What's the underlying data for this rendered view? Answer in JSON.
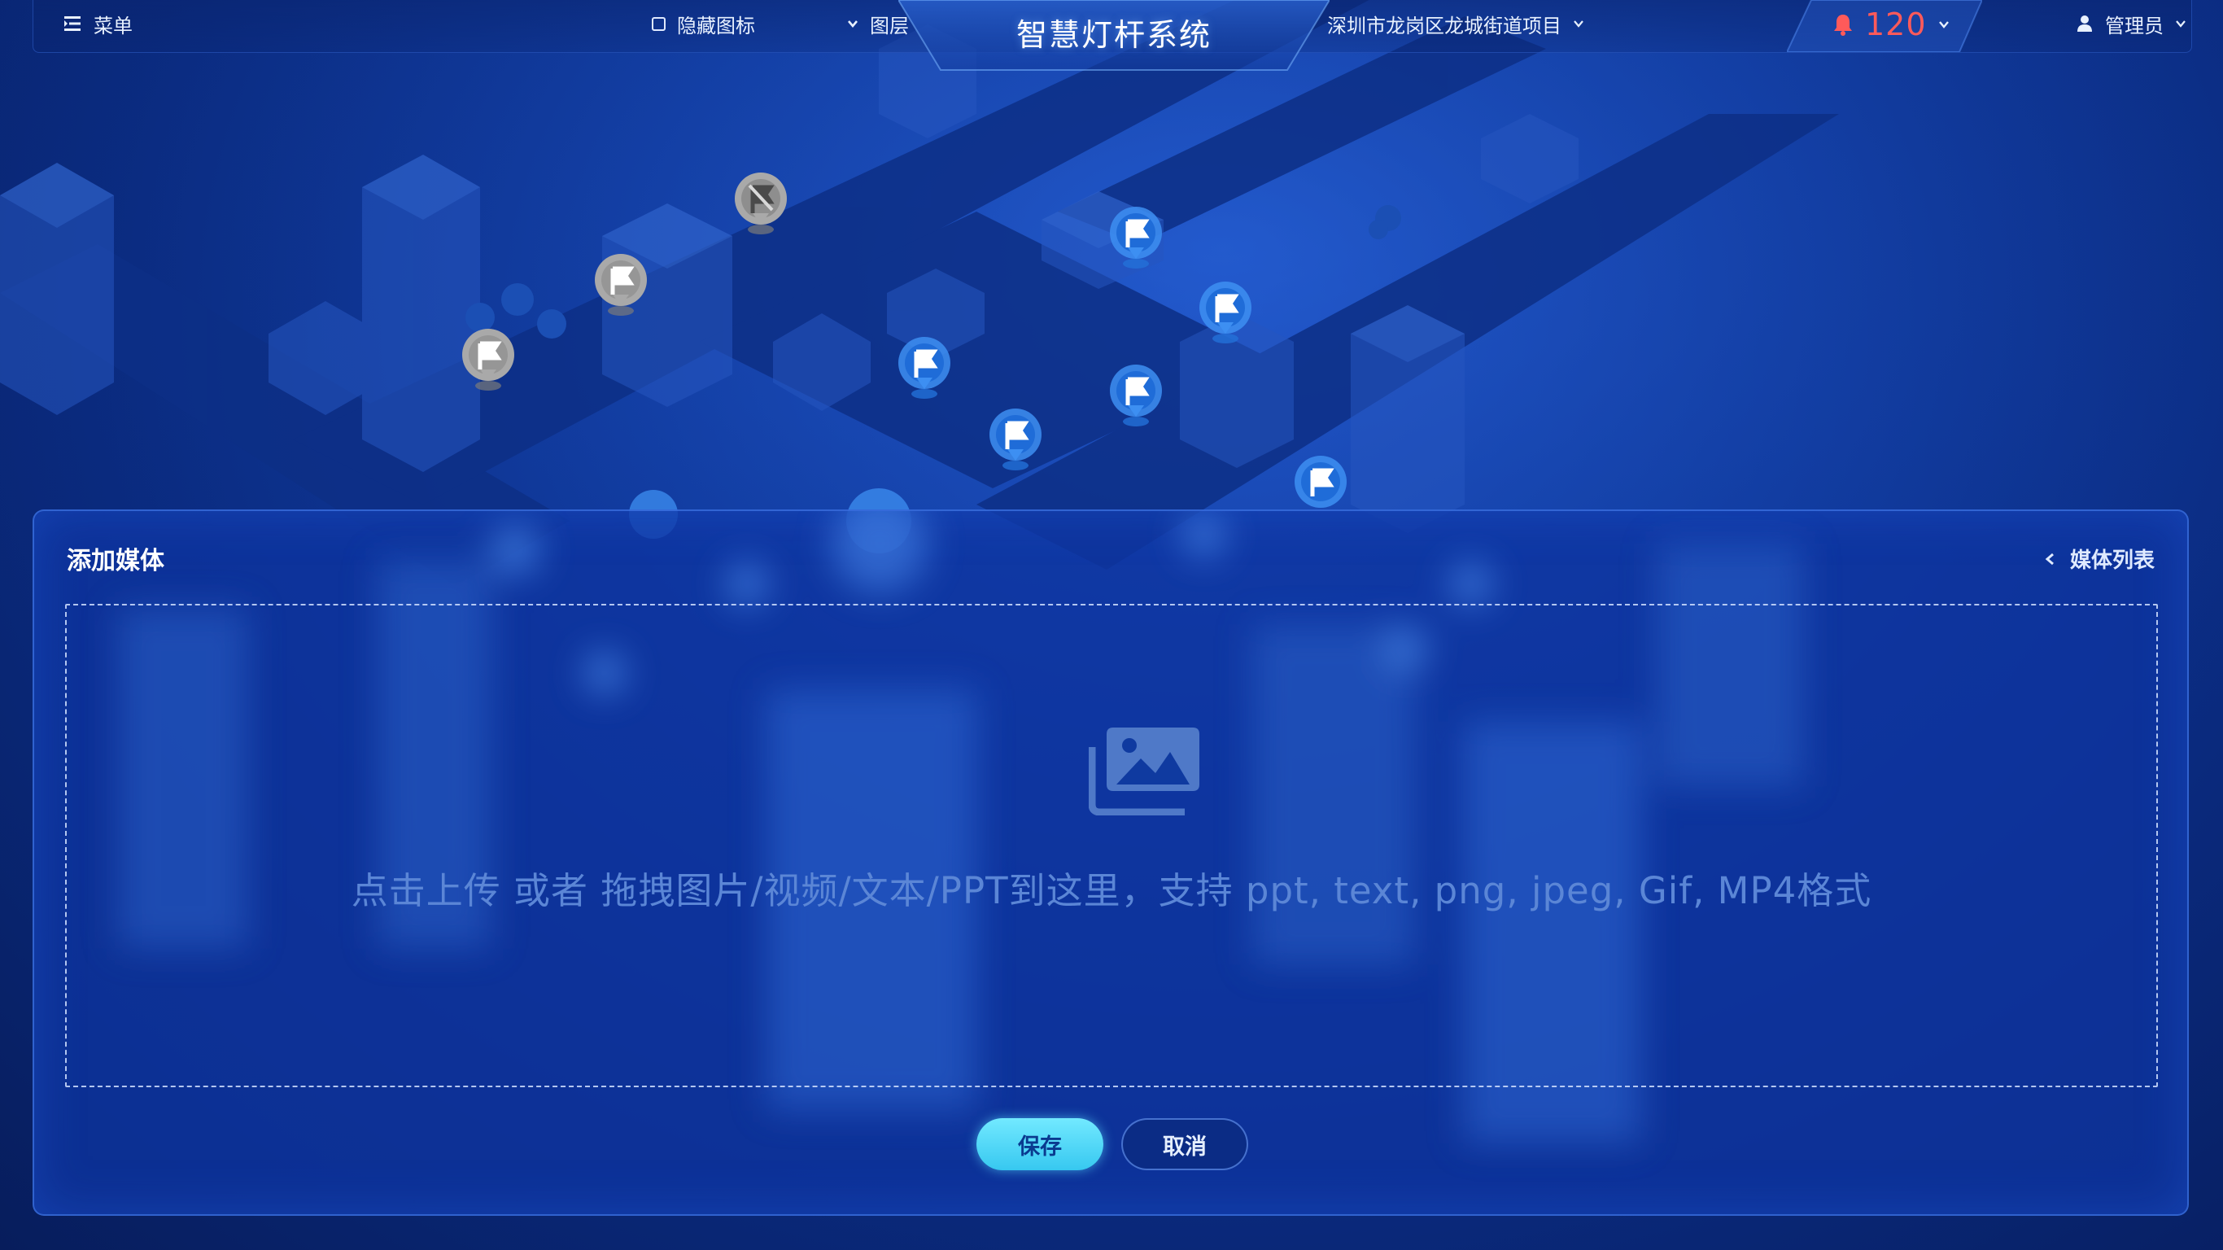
{
  "topbar": {
    "menu_label": "菜单",
    "hide_icons_label": "隐藏图标",
    "hide_icons_checked": false,
    "layer_label": "图层",
    "system_title": "智慧灯杆系统",
    "region_label": "深圳市龙岗区龙城街道项目",
    "alarm_count": "120",
    "user_label": "管理员"
  },
  "panel": {
    "title": "添加媒体",
    "media_list_link": "媒体列表",
    "upload_hint": "点击上传 或者 拖拽图片/视频/文本/PPT到这里，支持 ppt, text, png, jpeg, Gif, MP4格式",
    "save_label": "保存",
    "cancel_label": "取消"
  },
  "map": {
    "markers": [
      {
        "status": "offline-fault"
      },
      {
        "status": "offline"
      },
      {
        "status": "offline"
      },
      {
        "status": "online"
      },
      {
        "status": "online"
      },
      {
        "status": "online"
      },
      {
        "status": "online"
      },
      {
        "status": "online"
      },
      {
        "status": "online"
      }
    ]
  },
  "colors": {
    "accent": "#37c8f0",
    "alarm": "#ff5a5a",
    "marker_online": "#2f86ee",
    "marker_offline": "#9b9b9b"
  }
}
